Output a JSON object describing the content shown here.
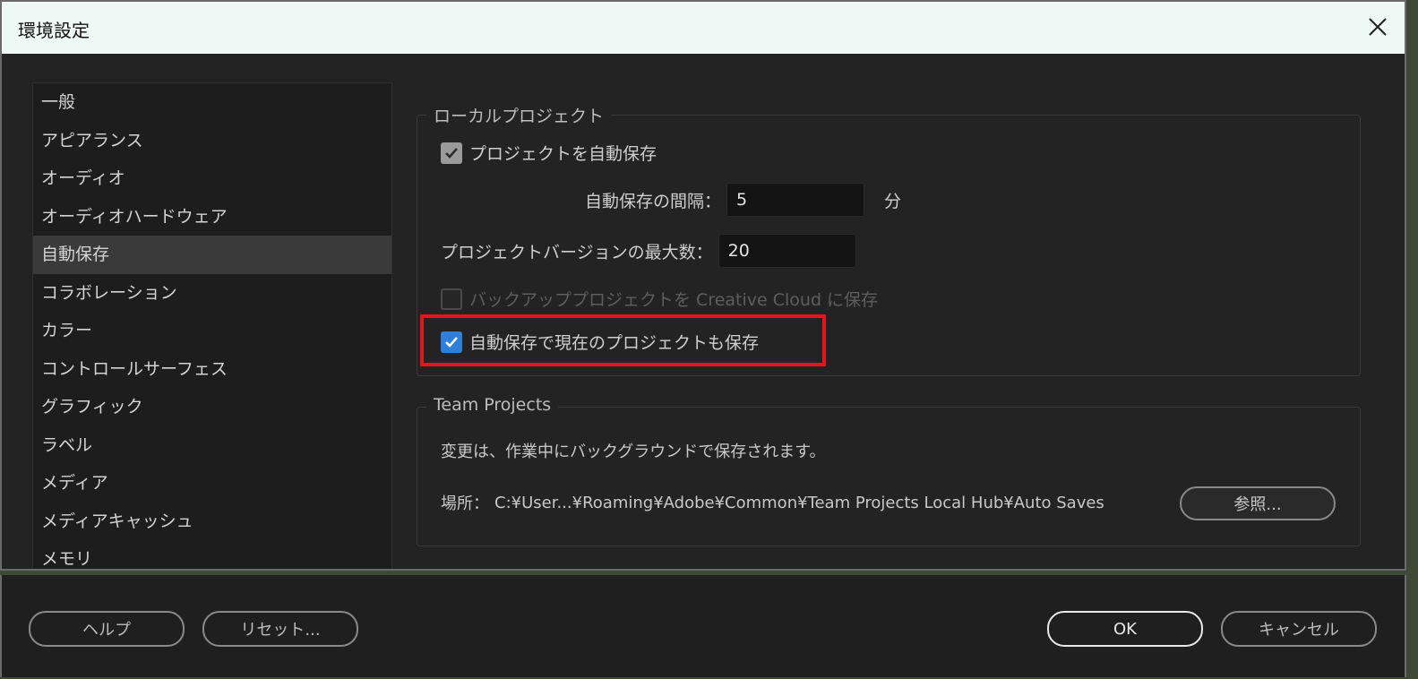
{
  "window": {
    "title": "環境設定"
  },
  "sidebar": {
    "items": [
      {
        "label": "一般"
      },
      {
        "label": "アピアランス"
      },
      {
        "label": "オーディオ"
      },
      {
        "label": "オーディオハードウェア"
      },
      {
        "label": "自動保存",
        "selected": true
      },
      {
        "label": "コラボレーション"
      },
      {
        "label": "カラー"
      },
      {
        "label": "コントロールサーフェス"
      },
      {
        "label": "グラフィック"
      },
      {
        "label": "ラベル"
      },
      {
        "label": "メディア"
      },
      {
        "label": "メディアキャッシュ"
      },
      {
        "label": "メモリ"
      }
    ]
  },
  "local": {
    "title": "ローカルプロジェクト",
    "autosave_label": "プロジェクトを自動保存",
    "interval_label": "自動保存の間隔：",
    "interval_value": "5",
    "interval_unit": "分",
    "max_versions_label": "プロジェクトバージョンの最大数：",
    "max_versions_value": "20",
    "backup_label": "バックアッププロジェクトを Creative Cloud に保存",
    "save_current_label": "自動保存で現在のプロジェクトも保存"
  },
  "team": {
    "title": "Team Projects",
    "info": "変更は、作業中にバックグラウンドで保存されます。",
    "location_label": "場所：",
    "location_value": "C:¥User...¥Roaming¥Adobe¥Common¥Team Projects Local Hub¥Auto Saves",
    "browse_label": "参照..."
  },
  "footer": {
    "help_label": "ヘルプ",
    "reset_label": "リセット...",
    "ok_label": "OK",
    "cancel_label": "キャンセル"
  },
  "colors": {
    "accent": "#2e7fd9",
    "highlight": "#e8141b"
  }
}
